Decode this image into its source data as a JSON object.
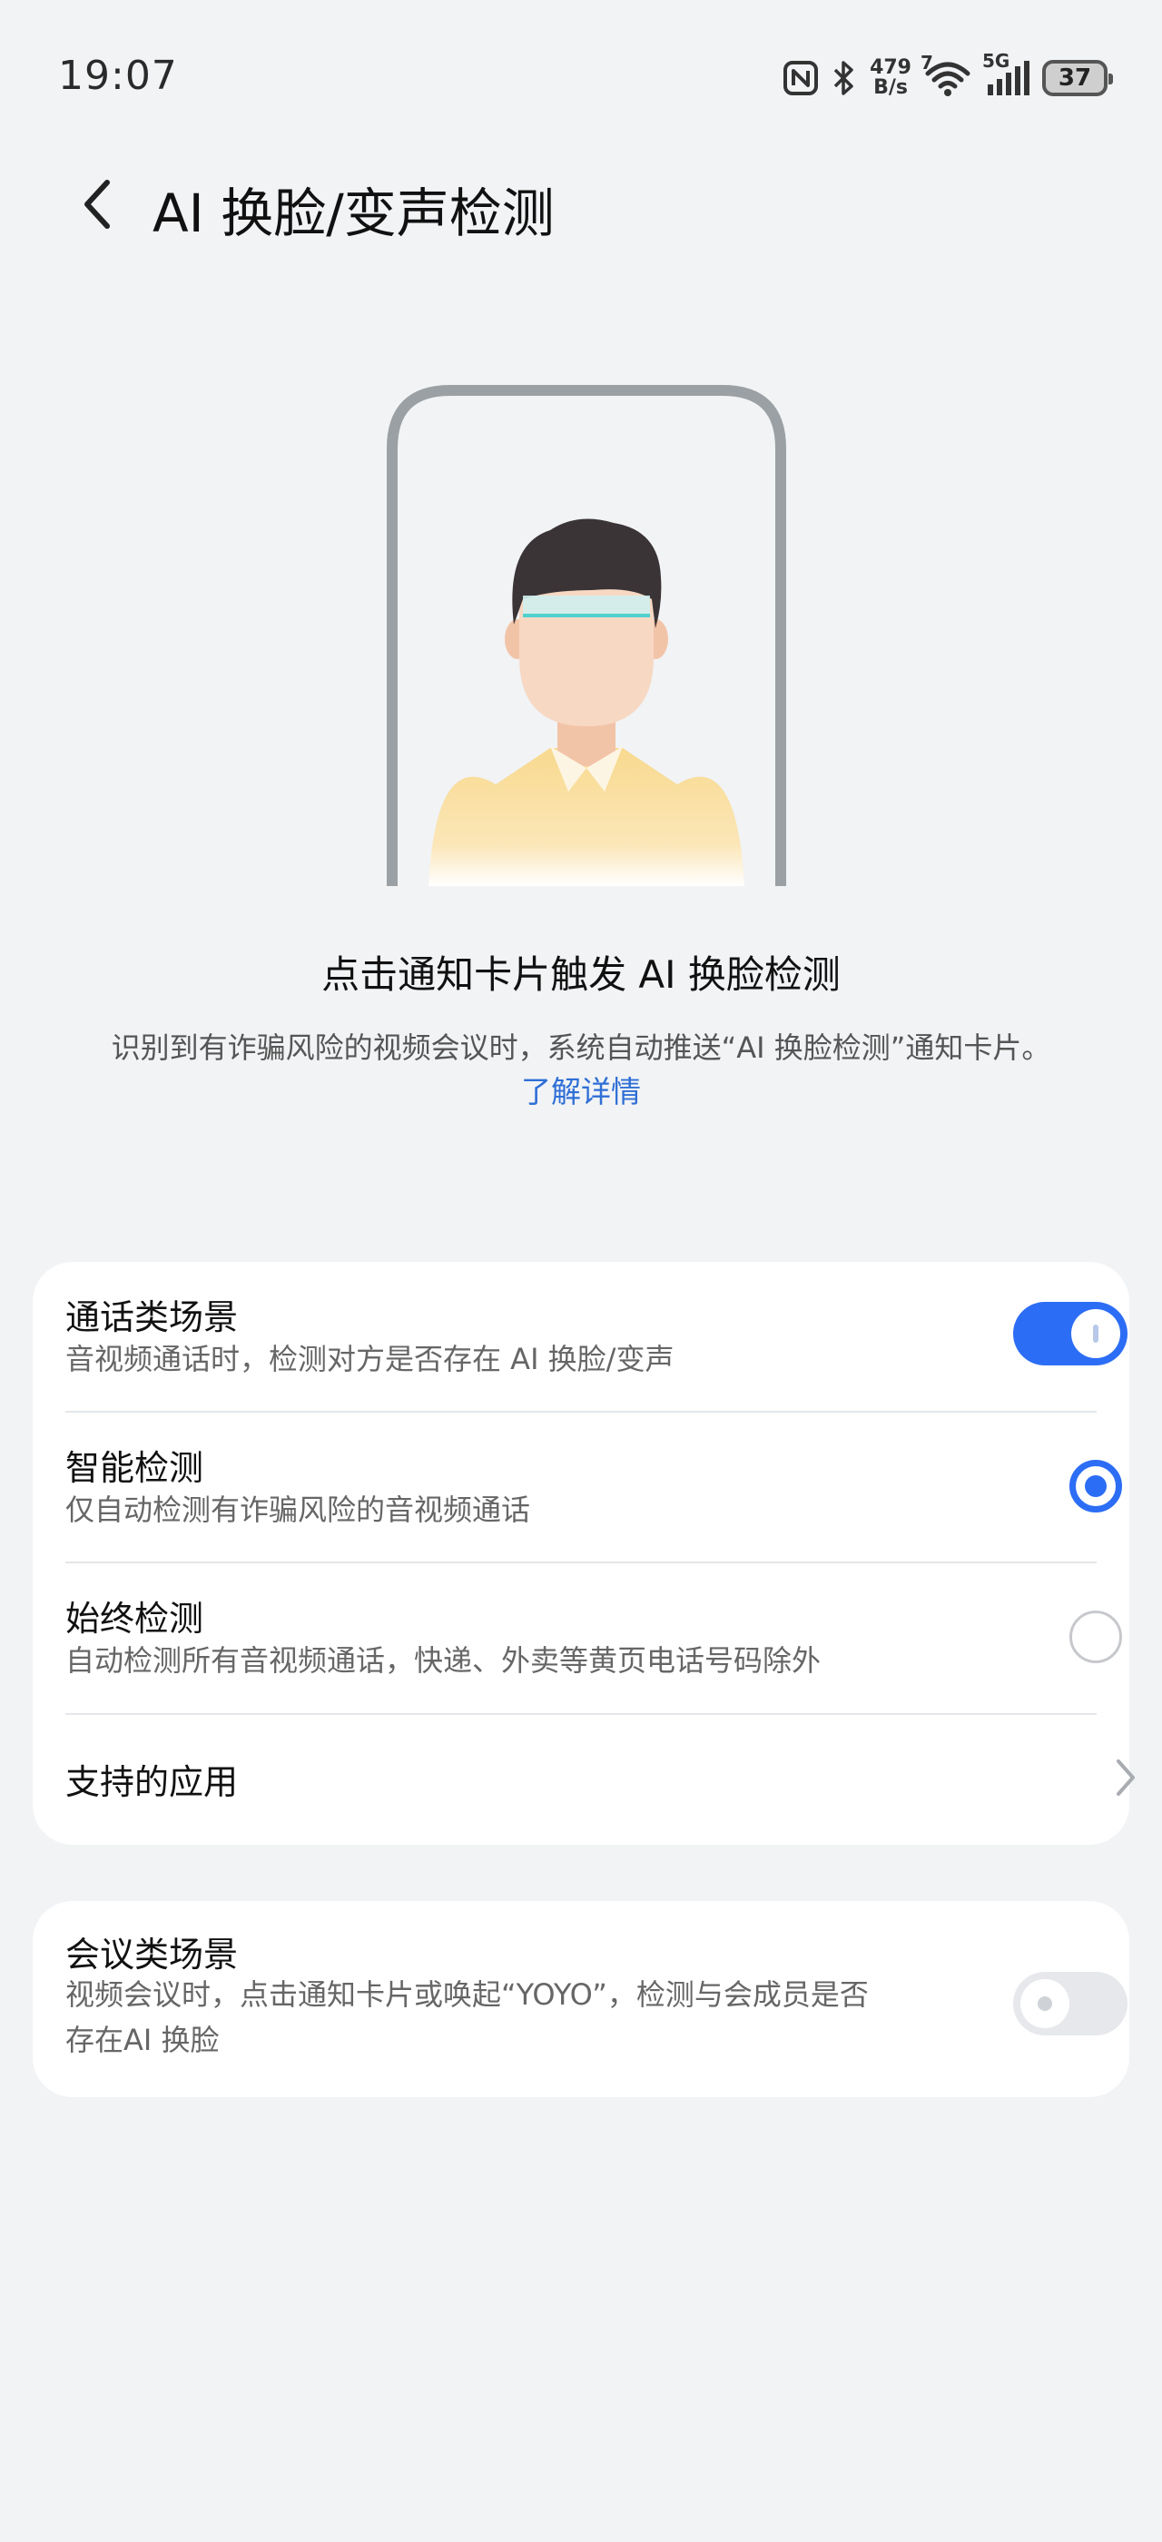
{
  "status_bar": {
    "time": "19:07",
    "net_speed_value": "479",
    "net_speed_unit": "B/s",
    "wifi_label": "7",
    "cell_label": "5G",
    "battery": "37",
    "icons": [
      "nfc-icon",
      "bluetooth-icon",
      "wifi-icon",
      "signal-icon",
      "battery-icon"
    ]
  },
  "header": {
    "title": "AI 换脸/变声检测"
  },
  "hero": {
    "title": "点击通知卡片触发 AI 换脸检测",
    "description": "识别到有诈骗风险的视频会议时，系统自动推送“AI 换脸检测”通知卡片。",
    "learn_more": "了解详情"
  },
  "call_card": {
    "toggle_row": {
      "title": "通话类场景",
      "subtitle": "音视频通话时，检测对方是否存在 AI 换脸/变声",
      "enabled": true
    },
    "smart_row": {
      "title": "智能检测",
      "subtitle": "仅自动检测有诈骗风险的音视频通话",
      "selected": true
    },
    "always_row": {
      "title": "始终检测",
      "subtitle": "自动检测所有音视频通话，快递、外卖等黄页电话号码除外",
      "selected": false
    },
    "apps_row": {
      "title": "支持的应用"
    }
  },
  "meeting_card": {
    "title": "会议类场景",
    "subtitle_line1": "视频会议时，点击通知卡片或唤起“YOYO”，检测与会成员是否",
    "subtitle_line2": "存在AI 换脸",
    "enabled": false
  },
  "colors": {
    "accent": "#2c6df5",
    "link": "#2f6fd6",
    "background": "#f1f3f5"
  }
}
